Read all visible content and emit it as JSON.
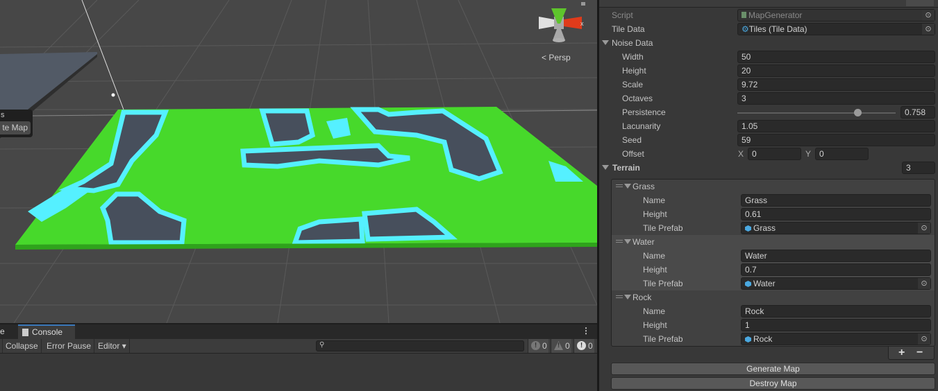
{
  "scene": {
    "view_mode": "Persp",
    "axis_label": "x",
    "overlay_title": "s",
    "overlay_button": "te Map",
    "colors": {
      "grass": "#47d92b",
      "water": "#55f0ff",
      "rock": "#474f5c",
      "background": "#474747"
    }
  },
  "console": {
    "tabs": [
      {
        "label": "e"
      },
      {
        "label": "Console"
      }
    ],
    "toolbar": {
      "collapse": "Collapse",
      "error_pause": "Error Pause",
      "editor": "Editor"
    },
    "search_placeholder": "",
    "counts": {
      "info": "0",
      "warning": "0",
      "error": "0"
    }
  },
  "inspector": {
    "script": {
      "label": "Script",
      "value": "MapGenerator"
    },
    "tile_data": {
      "label": "Tile Data",
      "value": "Tiles (Tile Data)"
    },
    "noise_data": {
      "label": "Noise Data",
      "width": {
        "label": "Width",
        "value": "50"
      },
      "height": {
        "label": "Height",
        "value": "20"
      },
      "scale": {
        "label": "Scale",
        "value": "9.72"
      },
      "octaves": {
        "label": "Octaves",
        "value": "3"
      },
      "persistence": {
        "label": "Persistence",
        "value": "0.758",
        "fraction": 0.758
      },
      "lacunarity": {
        "label": "Lacunarity",
        "value": "1.05"
      },
      "seed": {
        "label": "Seed",
        "value": "59"
      },
      "offset": {
        "label": "Offset",
        "x_label": "X",
        "x": "0",
        "y_label": "Y",
        "y": "0"
      }
    },
    "terrain": {
      "label": "Terrain",
      "count": "3",
      "name_label": "Name",
      "height_label": "Height",
      "prefab_label": "Tile Prefab",
      "items": [
        {
          "title": "Grass",
          "name": "Grass",
          "height": "0.61",
          "prefab": "Grass"
        },
        {
          "title": "Water",
          "name": "Water",
          "height": "0.7",
          "prefab": "Water"
        },
        {
          "title": "Rock",
          "name": "Rock",
          "height": "1",
          "prefab": "Rock"
        }
      ],
      "add": "+",
      "remove": "−"
    },
    "buttons": {
      "generate": "Generate Map",
      "destroy": "Destroy Map"
    }
  }
}
